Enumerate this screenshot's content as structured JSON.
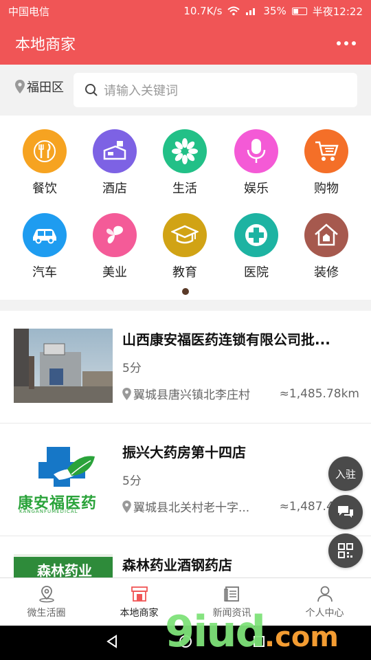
{
  "status_bar": {
    "carrier": "中国电信",
    "net_speed": "10.7K/s",
    "battery": "35%",
    "time": "半夜12:22"
  },
  "header": {
    "title": "本地商家"
  },
  "search": {
    "location": "福田区",
    "placeholder": "请输入关键词"
  },
  "categories": [
    {
      "label": "餐饮",
      "icon": "utensils-icon",
      "color": "#f6a321"
    },
    {
      "label": "酒店",
      "icon": "hotel-bed-icon",
      "color": "#7d62e4"
    },
    {
      "label": "生活",
      "icon": "flower-icon",
      "color": "#22c087"
    },
    {
      "label": "娱乐",
      "icon": "microphone-icon",
      "color": "#f45ad6"
    },
    {
      "label": "购物",
      "icon": "shopping-cart-icon",
      "color": "#f46f28"
    },
    {
      "label": "汽车",
      "icon": "car-icon",
      "color": "#1e9cf0"
    },
    {
      "label": "美业",
      "icon": "butterfly-icon",
      "color": "#f45b98"
    },
    {
      "label": "教育",
      "icon": "graduation-cap-icon",
      "color": "#d1a315"
    },
    {
      "label": "医院",
      "icon": "medical-cross-icon",
      "color": "#1db3a2"
    },
    {
      "label": "装修",
      "icon": "house-icon",
      "color": "#a6594e"
    }
  ],
  "merchants": [
    {
      "name": "山西康安福医药连锁有限公司批...",
      "score": "5分",
      "address": "翼城县唐兴镇北李庄村",
      "distance": "≈1,485.78km"
    },
    {
      "name": "振兴大药房第十四店",
      "score": "5分",
      "address": "翼城县北关村老十字...",
      "distance": "≈1,487.47km",
      "logo_text": "康安福医药",
      "logo_subtext": "KANGANFUMEDICAL"
    },
    {
      "name": "森林药业酒钢药店",
      "logo_text": "森林药业"
    }
  ],
  "floating": {
    "join_label": "入驻"
  },
  "tabbar": [
    {
      "label": "微生活圈",
      "icon": "location-pin-icon"
    },
    {
      "label": "本地商家",
      "icon": "storefront-icon",
      "active": true,
      "color": "#f05556"
    },
    {
      "label": "新闻资讯",
      "icon": "news-icon"
    },
    {
      "label": "个人中心",
      "icon": "person-icon"
    }
  ],
  "watermark": {
    "text": "9iud",
    "suffix": ".com"
  }
}
